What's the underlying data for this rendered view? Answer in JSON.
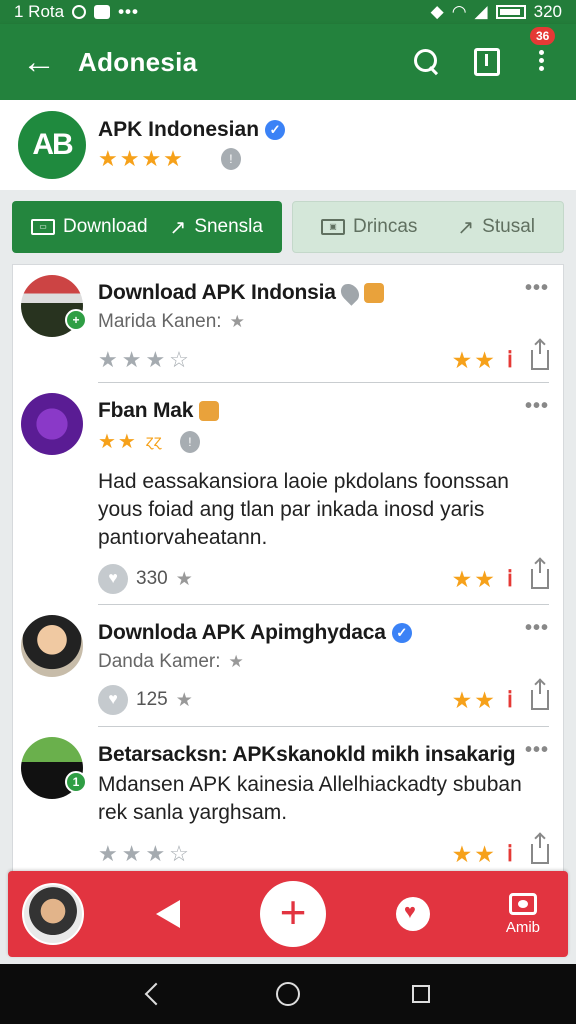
{
  "status": {
    "carrier": "1 Rota",
    "dots": "•••",
    "battery_value": "320"
  },
  "appbar": {
    "back_glyph": "←",
    "title": "Adonesia",
    "badge": "36"
  },
  "app": {
    "logo_text": "AB",
    "name": "APK Indonesian",
    "rating_stars": "★★★★"
  },
  "tabs": [
    {
      "label": "Download",
      "label2": "Snensla"
    },
    {
      "label": "Drincas",
      "label2": "Stusal"
    }
  ],
  "posts": [
    {
      "title": "Download APK Indonsia",
      "subtitle": "Marida Kanen:",
      "grey_stars": "★★★☆",
      "stars": "★★",
      "mark": "ⅰ",
      "more": "•••"
    },
    {
      "title": "Fban Mak",
      "stars_line": "★★",
      "stars_line_extra": "ɀɀ",
      "text": "Had eassakansiora laoie pkdolans foonssan yous foiad ang tlan par inkada inosd yaris pantıorvaheatann.",
      "likes": "330",
      "stars": "★★",
      "mark": "ⅰ",
      "more": "•••"
    },
    {
      "title": "Downloda APK Apimghydaca",
      "subtitle": "Danda Kamer:",
      "likes": "125",
      "stars": "★★",
      "mark": "ⅰ",
      "more": "•••"
    },
    {
      "title": "Betarsacksn: APKskanokld mikh insakarig",
      "text": "Mdansen APK kainesia Allelhiackadty sbuban rek sanla yarghsam.",
      "grey_stars": "★★★☆",
      "stars": "★★",
      "mark": "ⅰ",
      "more": "•••"
    }
  ],
  "actionbar": {
    "plus": "+",
    "rec_label": "Amib"
  },
  "colors": {
    "primary": "#23823d",
    "accent": "#e23440",
    "star": "#f6a11a"
  }
}
